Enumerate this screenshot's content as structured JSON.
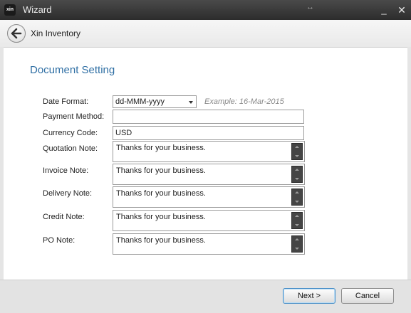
{
  "window": {
    "title": "Wizard",
    "logo_text": "xin",
    "resize_glyph": "↔",
    "minimize_glyph": "_",
    "close_glyph": "✕"
  },
  "nav": {
    "title": "Xin Inventory",
    "back_icon": "back-arrow-icon"
  },
  "section": {
    "title": "Document Setting"
  },
  "form": {
    "date_format": {
      "label": "Date Format:",
      "value": "dd-MMM-yyyy",
      "example": "Example: 16-Mar-2015"
    },
    "payment_method": {
      "label": "Payment Method:",
      "value": ""
    },
    "currency_code": {
      "label": "Currency Code:",
      "value": "USD"
    },
    "notes": [
      {
        "label": "Quotation Note:",
        "value": "Thanks for your business."
      },
      {
        "label": "Invoice Note:",
        "value": "Thanks for your business."
      },
      {
        "label": "Delivery Note:",
        "value": "Thanks for your business."
      },
      {
        "label": "Credit Note:",
        "value": "Thanks for your business."
      },
      {
        "label": "PO Note:",
        "value": "Thanks for your business."
      }
    ]
  },
  "footer": {
    "next_label": "Next >",
    "cancel_label": "Cancel"
  },
  "colors": {
    "accent": "#2f6fa4",
    "titlebar": "#2c2c2c",
    "focus_border": "#4a90c8"
  }
}
